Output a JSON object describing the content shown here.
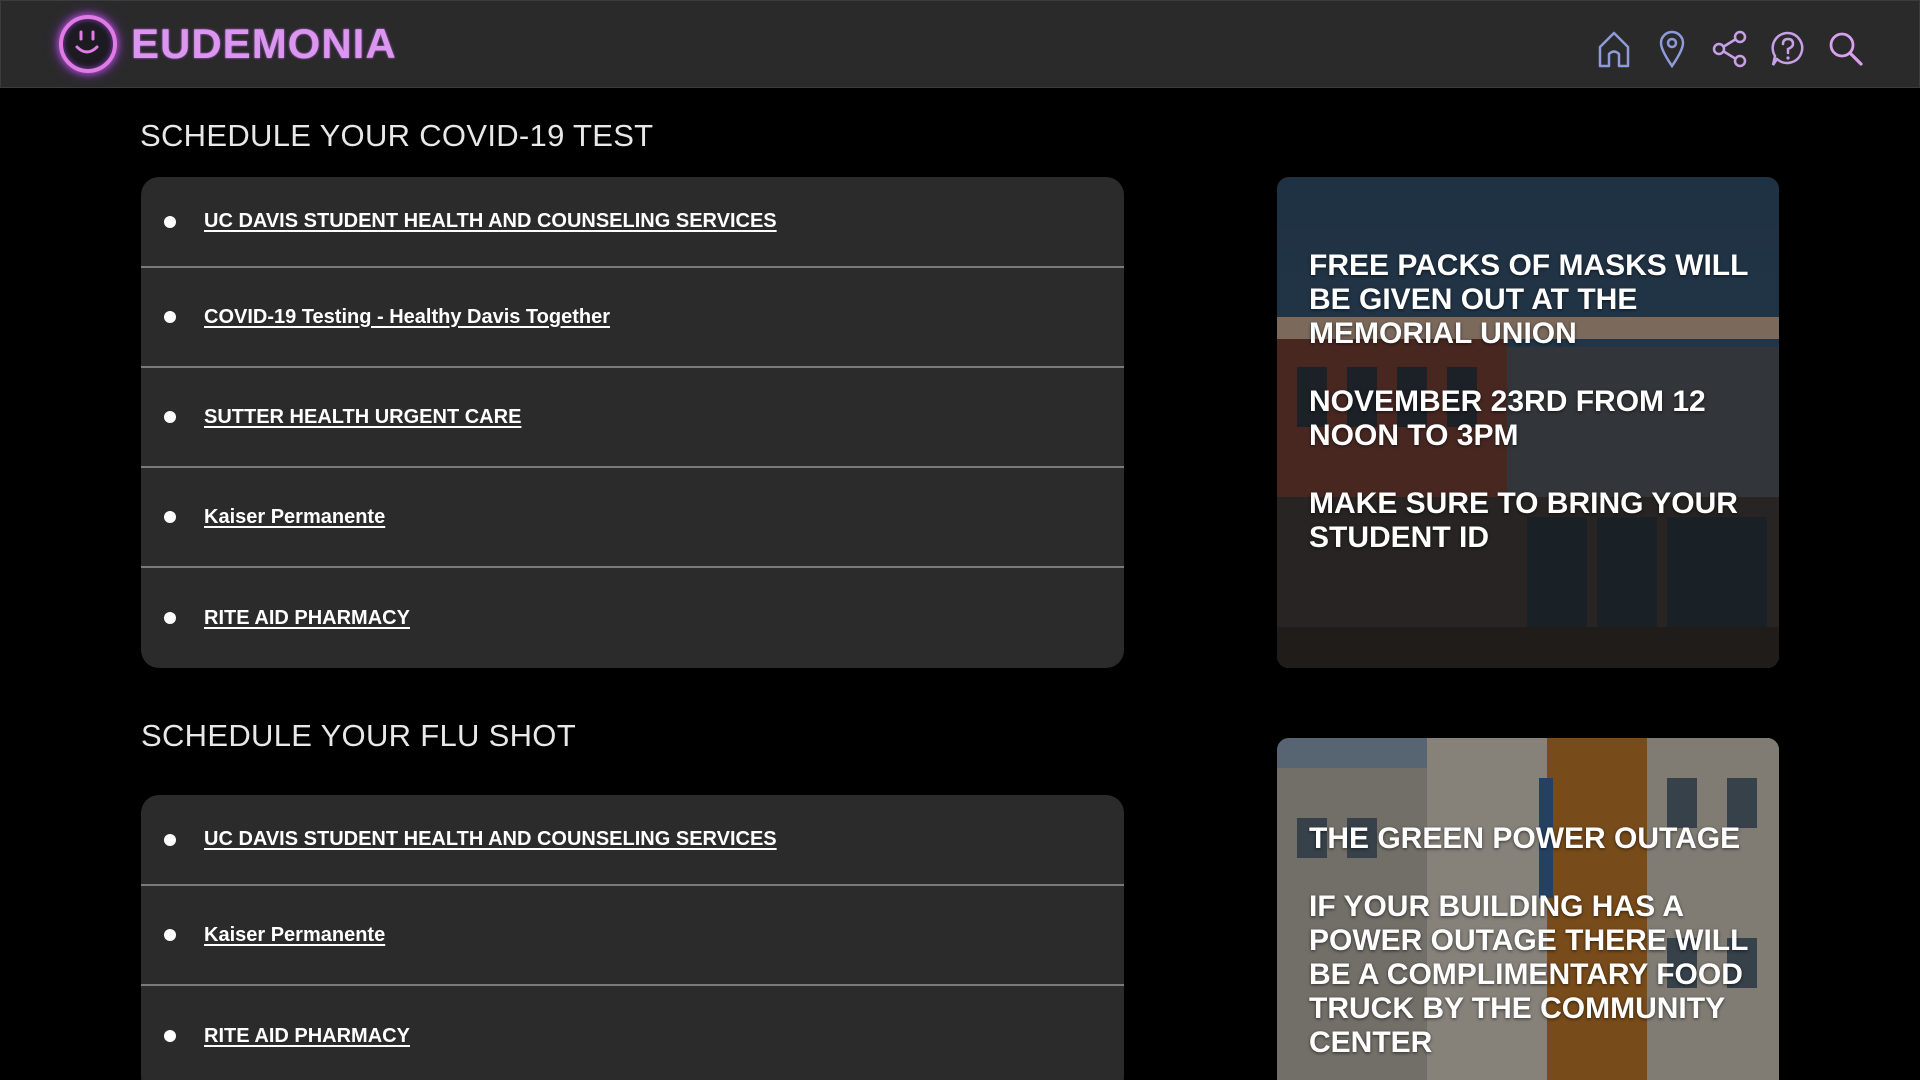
{
  "header": {
    "brand": "EUDEMONIA",
    "nav": [
      {
        "icon": "home-icon"
      },
      {
        "icon": "location-pin-icon"
      },
      {
        "icon": "share-icon"
      },
      {
        "icon": "help-icon"
      },
      {
        "icon": "search-icon"
      }
    ],
    "accent": "#dd96f0"
  },
  "covid": {
    "title": "SCHEDULE YOUR COVID-19 TEST",
    "links": [
      "UC DAVIS STUDENT HEALTH AND COUNSELING SERVICES",
      "COVID-19 Testing - Healthy Davis Together",
      "SUTTER HEALTH URGENT CARE",
      "Kaiser Permanente",
      "RITE AID PHARMACY"
    ]
  },
  "flu": {
    "title": "SCHEDULE YOUR FLU SHOT",
    "links": [
      "UC DAVIS STUDENT HEALTH AND COUNSELING SERVICES",
      "Kaiser Permanente",
      "RITE AID PHARMACY"
    ]
  },
  "promos": [
    {
      "lines": [
        "FREE PACKS OF MASKS WILL BE GIVEN OUT AT THE MEMORIAL UNION",
        "NOVEMBER 23RD FROM 12 NOON TO 3PM",
        "MAKE SURE TO BRING YOUR STUDENT ID"
      ]
    },
    {
      "lines": [
        "THE GREEN POWER OUTAGE",
        "IF YOUR BUILDING HAS A POWER OUTAGE THERE WILL BE A COMPLIMENTARY FOOD TRUCK BY THE COMMUNITY CENTER"
      ]
    }
  ]
}
